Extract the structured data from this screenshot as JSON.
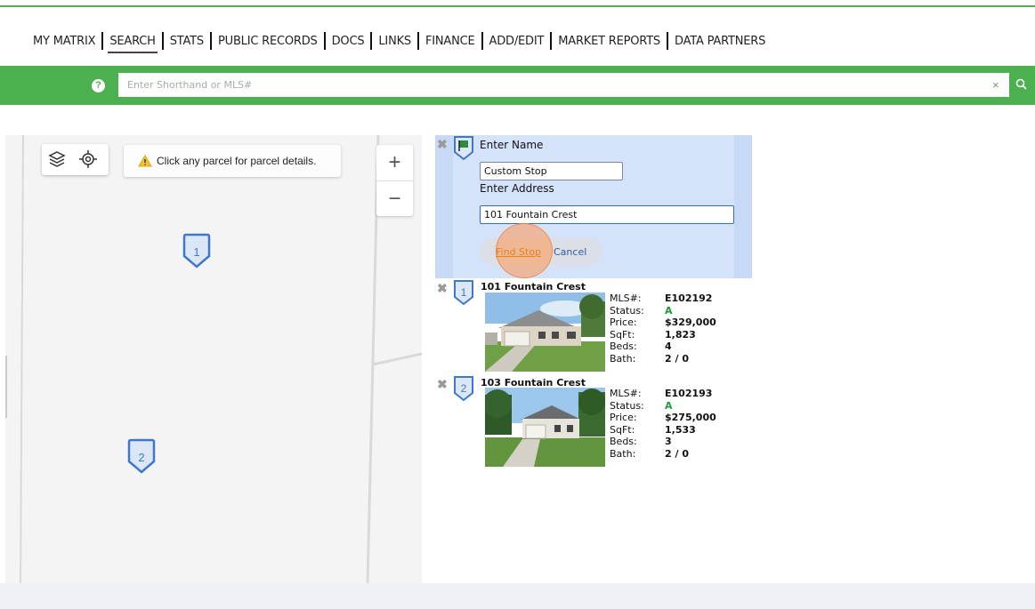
{
  "nav": {
    "items": [
      "MY MATRIX",
      "SEARCH",
      "STATS",
      "PUBLIC RECORDS",
      "DOCS",
      "LINKS",
      "FINANCE",
      "ADD/EDIT",
      "MARKET REPORTS",
      "DATA PARTNERS"
    ],
    "active": "SEARCH"
  },
  "search": {
    "placeholder": "Enter Shorthand or MLS#",
    "help_icon": "?",
    "clear_icon": "×"
  },
  "map": {
    "tip": "Click any parcel for parcel details.",
    "zoom_in": "+",
    "zoom_out": "−",
    "pins": [
      "1",
      "2"
    ]
  },
  "stop_form": {
    "name_label": "Enter Name",
    "name_value": "Custom Stop",
    "address_label": "Enter Address",
    "address_value": "101 Fountain Crest",
    "find_button": "Find Stop",
    "cancel_button": "Cancel"
  },
  "listings": [
    {
      "index": "1",
      "address": "101 Fountain Crest",
      "mls_label": "MLS#:",
      "mls": "E102192",
      "status_label": "Status:",
      "status": "A",
      "price_label": "Price:",
      "price": "$329,000",
      "sqft_label": "SqFt:",
      "sqft": "1,823",
      "beds_label": "Beds:",
      "beds": "4",
      "bath_label": "Bath:",
      "bath": "2 / 0"
    },
    {
      "index": "2",
      "address": "103 Fountain Crest",
      "mls_label": "MLS#:",
      "mls": "E102193",
      "status_label": "Status:",
      "status": "A",
      "price_label": "Price:",
      "price": "$275,000",
      "sqft_label": "SqFt:",
      "sqft": "1,533",
      "beds_label": "Beds:",
      "beds": "3",
      "bath_label": "Bath:",
      "bath": "2 / 0"
    }
  ],
  "colors": {
    "brand_green": "#4caf50",
    "form_blue": "#d5e3fa",
    "pin_blue": "#3f79c6",
    "active_status": "#1f9a3a"
  }
}
